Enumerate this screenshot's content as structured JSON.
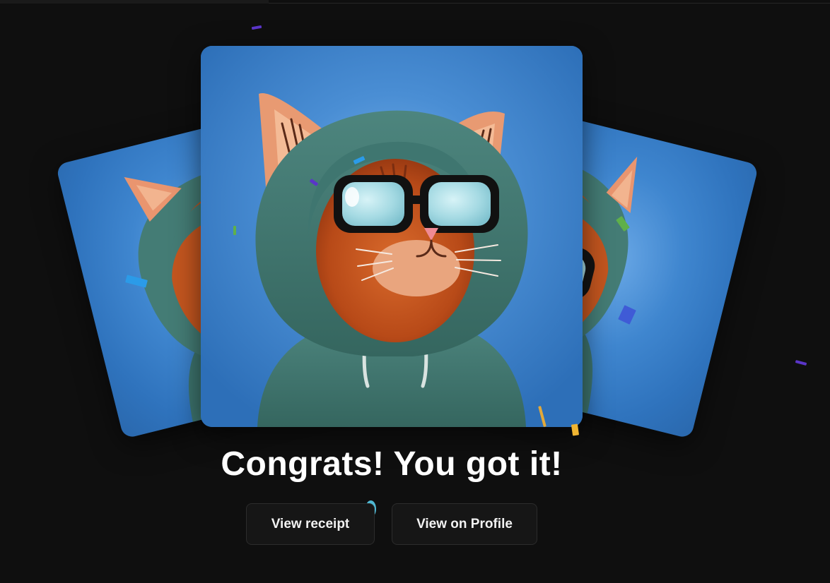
{
  "headline": "Congrats! You got it!",
  "buttons": {
    "view_receipt": "View receipt",
    "view_profile": "View on Profile"
  },
  "cards": [
    {
      "position": "left",
      "icon": "cat-hoodie-glasses-avatar"
    },
    {
      "position": "center",
      "icon": "cat-hoodie-glasses-avatar"
    },
    {
      "position": "right",
      "icon": "cat-hoodie-glasses-avatar"
    }
  ],
  "colors": {
    "background": "#0f0f0f",
    "card_blue": "#3f86cf",
    "hoodie": "#3f7670",
    "cat_fur": "#c4561f",
    "ear_pink": "#f2a07f",
    "lens": "#a8dde4",
    "button_bg": "#161616",
    "text": "#ffffff"
  }
}
